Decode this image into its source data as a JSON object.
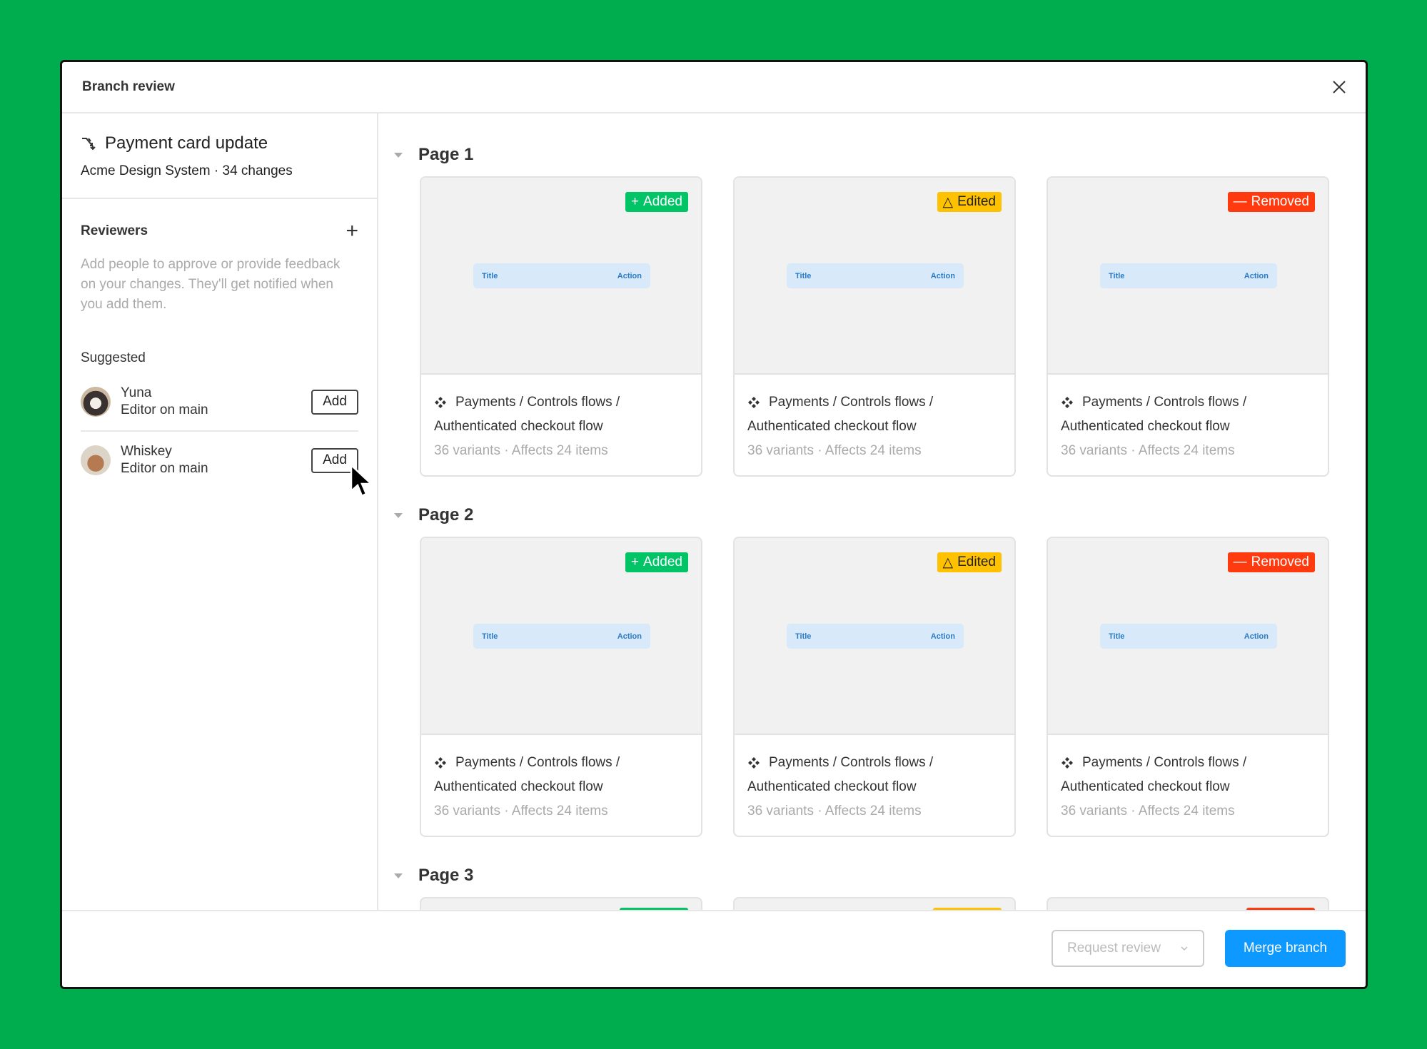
{
  "dialog": {
    "title": "Branch review"
  },
  "branch": {
    "name": "Payment card update",
    "subtitle": "Acme Design System · 34 changes"
  },
  "reviewers": {
    "heading": "Reviewers",
    "description": "Add people to approve or provide feedback on your changes. They'll get notified when you add them.",
    "suggested_label": "Suggested",
    "people": [
      {
        "name": "Yuna",
        "role": "Editor on main",
        "add_label": "Add"
      },
      {
        "name": "Whiskey",
        "role": "Editor on main",
        "add_label": "Add"
      }
    ]
  },
  "pages": [
    {
      "title": "Page 1",
      "cards": [
        {
          "status": "added",
          "badge": "Added",
          "preview_title": "Title",
          "preview_action": "Action",
          "path": "Payments / Controls flows /",
          "name": "Authenticated checkout flow",
          "meta": "36 variants · Affects 24 items"
        },
        {
          "status": "edited",
          "badge": "Edited",
          "preview_title": "Title",
          "preview_action": "Action",
          "path": "Payments / Controls flows /",
          "name": "Authenticated checkout flow",
          "meta": "36 variants · Affects 24 items"
        },
        {
          "status": "removed",
          "badge": "Removed",
          "preview_title": "Title",
          "preview_action": "Action",
          "path": "Payments / Controls flows /",
          "name": "Authenticated checkout flow",
          "meta": "36 variants · Affects 24 items"
        }
      ]
    },
    {
      "title": "Page 2",
      "cards": [
        {
          "status": "added",
          "badge": "Added",
          "preview_title": "Title",
          "preview_action": "Action",
          "path": "Payments / Controls flows /",
          "name": "Authenticated checkout flow",
          "meta": "36 variants · Affects 24 items"
        },
        {
          "status": "edited",
          "badge": "Edited",
          "preview_title": "Title",
          "preview_action": "Action",
          "path": "Payments / Controls flows /",
          "name": "Authenticated checkout flow",
          "meta": "36 variants · Affects 24 items"
        },
        {
          "status": "removed",
          "badge": "Removed",
          "preview_title": "Title",
          "preview_action": "Action",
          "path": "Payments / Controls flows /",
          "name": "Authenticated checkout flow",
          "meta": "36 variants · Affects 24 items"
        }
      ]
    },
    {
      "title": "Page 3",
      "cards": [
        {
          "status": "added"
        },
        {
          "status": "edited"
        },
        {
          "status": "removed"
        }
      ]
    }
  ],
  "footer": {
    "request_review": "Request review",
    "merge": "Merge branch"
  },
  "colors": {
    "added": "#00c466",
    "edited": "#ffc200",
    "removed": "#ff3a0f",
    "primary": "#0d99ff",
    "background": "#00ad4e"
  }
}
